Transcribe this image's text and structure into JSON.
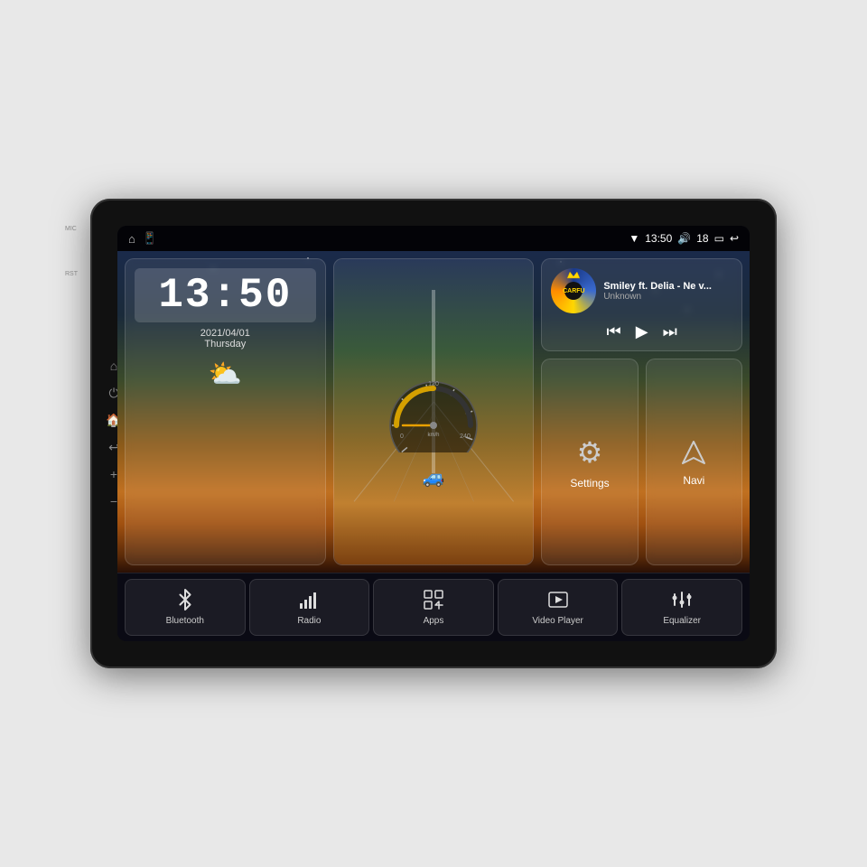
{
  "device": {
    "title": "Car Android Head Unit"
  },
  "status_bar": {
    "left_icon_home": "⌂",
    "left_icon_phone": "📱",
    "time": "13:50",
    "wifi_icon": "▼",
    "volume_icon": "🔊",
    "volume_level": "18",
    "battery_icon": "▭",
    "back_icon": "↩"
  },
  "clock_widget": {
    "time": "13:50",
    "date": "2021/04/01",
    "day": "Thursday",
    "weather_icon": "⛅"
  },
  "music_widget": {
    "title": "Smiley ft. Delia - Ne v...",
    "artist": "Unknown",
    "logo": "CARFU",
    "prev_icon": "⏮",
    "play_icon": "▶",
    "next_icon": "⏭"
  },
  "settings_widget": {
    "label": "Settings",
    "icon": "⚙"
  },
  "navi_widget": {
    "label": "Navi",
    "icon": "◭"
  },
  "bottom_buttons": [
    {
      "id": "bluetooth",
      "label": "Bluetooth",
      "icon": "bluetooth"
    },
    {
      "id": "radio",
      "label": "Radio",
      "icon": "radio"
    },
    {
      "id": "apps",
      "label": "Apps",
      "icon": "apps"
    },
    {
      "id": "video-player",
      "label": "Video Player",
      "icon": "video"
    },
    {
      "id": "equalizer",
      "label": "Equalizer",
      "icon": "equalizer"
    }
  ],
  "side_labels": {
    "mic": "MIC",
    "rst": "RST"
  }
}
